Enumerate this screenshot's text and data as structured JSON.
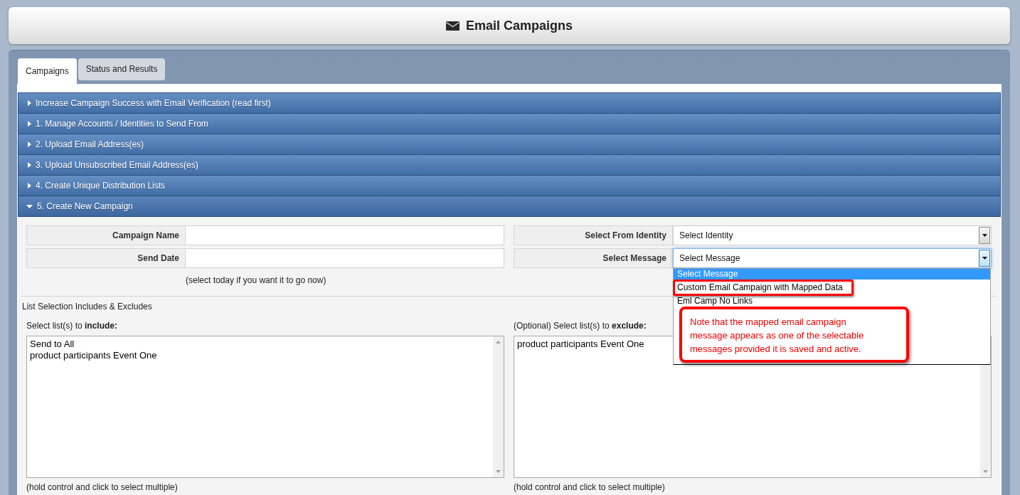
{
  "header": {
    "title": "Email Campaigns"
  },
  "tabs": [
    {
      "label": "Campaigns",
      "selected": true
    },
    {
      "label": "Status and Results",
      "selected": false
    }
  ],
  "sections": [
    {
      "title": "Increase Campaign Success with Email Verification (read first)",
      "expanded": false
    },
    {
      "title": "1. Manage Accounts / Identities to Send From",
      "expanded": false
    },
    {
      "title": "2. Upload Email Address(es)",
      "expanded": false
    },
    {
      "title": "3. Upload Unsubscribed Email Address(es)",
      "expanded": false
    },
    {
      "title": "4. Create Unique Distribution Lists",
      "expanded": false
    },
    {
      "title": "5. Create New Campaign",
      "expanded": true
    }
  ],
  "campaign_form": {
    "left_fields": [
      {
        "label": "Campaign Name"
      },
      {
        "label": "Send Date"
      }
    ],
    "date_hint": "(select today if you want it to go now)",
    "right_fields": [
      {
        "label": "Select From Identity",
        "value": "Select Identity",
        "open": false
      },
      {
        "label": "Select Message",
        "value": "Select Message",
        "open": true,
        "options": [
          {
            "label": "Select Message",
            "selected": true,
            "highlighted": false
          },
          {
            "label": "Custom Email Campaign with Mapped Data",
            "selected": false,
            "highlighted": true
          },
          {
            "label": "Eml Camp No Links",
            "selected": false,
            "highlighted": false
          }
        ]
      }
    ]
  },
  "list_selection": {
    "title": "List Selection Includes & Excludes",
    "lists": [
      {
        "label": "Select list(s) to **include:**",
        "items": [
          {
            "label": "Send to All",
            "selected": false
          },
          {
            "label": "product participants Event One",
            "selected": false
          }
        ],
        "hint": "(hold control and click to select multiple)"
      },
      {
        "label": "(Optional) Select list(s) to **exclude:**",
        "items": [
          {
            "label": "product participants Event One",
            "selected": false
          }
        ],
        "hint": "(hold control and click to select multiple)"
      }
    ]
  },
  "callout": {
    "text": "Note that the mapped email campaign message appears as one of the selectable messages provided it is saved and active."
  }
}
